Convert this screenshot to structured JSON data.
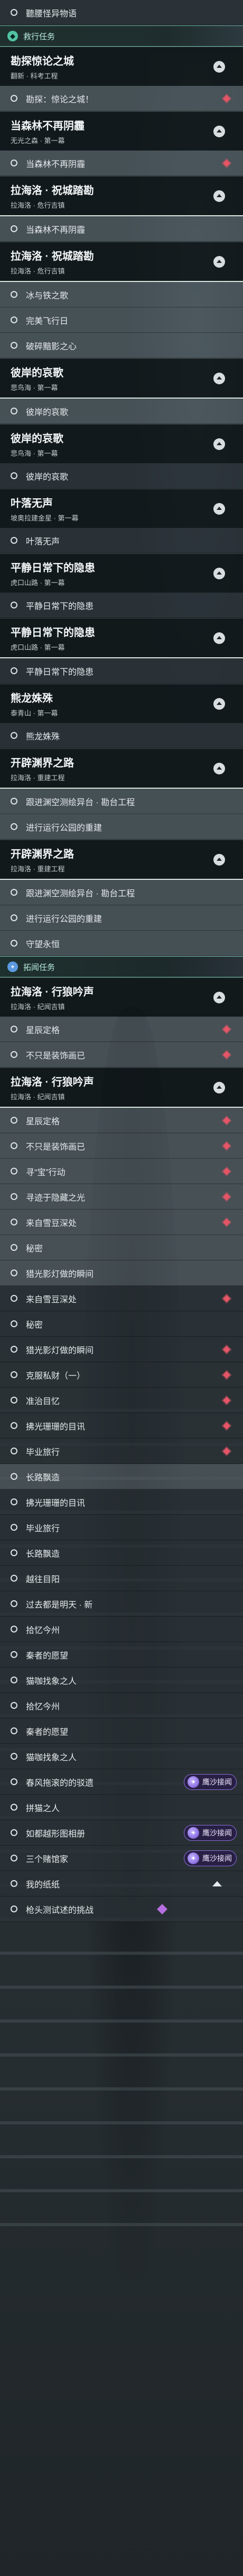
{
  "colors": {
    "accent_teal": "#6fb8a5",
    "marker_red": "#e45566",
    "badge_purple": "#8b6fd8"
  },
  "categories": {
    "main": {
      "label": "救行任务",
      "icon": "task-icon"
    },
    "side": {
      "label": "拓闻任务",
      "icon": "plus-icon"
    }
  },
  "rows": [
    {
      "kind": "task",
      "text": "聽腰怪异物语",
      "marker": false,
      "shade": "dark"
    },
    {
      "kind": "category",
      "ref": "main"
    },
    {
      "kind": "group",
      "title": "勘探惊论之城",
      "sub": "翻新 · 科考工程",
      "selected": false
    },
    {
      "kind": "task",
      "text": "勘探：惊论之城！",
      "marker": true,
      "shade": "light"
    },
    {
      "kind": "group",
      "title": "当森林不再阴霾",
      "sub": "无光之森 · 第一幕",
      "selected": false
    },
    {
      "kind": "task",
      "text": "当森林不再阴霾",
      "marker": true,
      "shade": "light"
    },
    {
      "kind": "group",
      "title": "拉海洛 · 祝城踏勘",
      "sub": "拉海洛 · 危行吉镇",
      "selected": true
    },
    {
      "kind": "task",
      "text": "当森林不再阴霾",
      "marker": false,
      "shade": "light"
    },
    {
      "kind": "group",
      "title": "拉海洛 · 祝城踏勘",
      "sub": "拉海洛 · 危行吉镇",
      "selected": true
    },
    {
      "kind": "task",
      "text": "冰与铁之歌",
      "marker": false,
      "shade": "light"
    },
    {
      "kind": "task",
      "text": "完美飞行日",
      "marker": false,
      "shade": "light"
    },
    {
      "kind": "task",
      "text": "破碎黯影之心",
      "marker": false,
      "shade": "light"
    },
    {
      "kind": "group",
      "title": "彼岸的哀歌",
      "sub": "悲鸟海 · 第一幕",
      "selected": true
    },
    {
      "kind": "task",
      "text": "彼岸的哀歌",
      "marker": false,
      "shade": "light"
    },
    {
      "kind": "group",
      "title": "彼岸的哀歌",
      "sub": "悲鸟海 · 第一幕",
      "selected": false
    },
    {
      "kind": "task",
      "text": "彼岸的哀歌",
      "marker": false,
      "shade": "dark"
    },
    {
      "kind": "group",
      "title": "叶落无声",
      "sub": "坡奥拉建金星 · 第一幕",
      "selected": false
    },
    {
      "kind": "task",
      "text": "叶落无声",
      "marker": false,
      "shade": "dark"
    },
    {
      "kind": "group",
      "title": "平静日常下的隐患",
      "sub": "虎口山路 · 第一幕",
      "selected": false
    },
    {
      "kind": "task",
      "text": "平静日常下的隐患",
      "marker": false,
      "shade": "dark"
    },
    {
      "kind": "group",
      "title": "平静日常下的隐患",
      "sub": "虎口山路 · 第一幕",
      "selected": true
    },
    {
      "kind": "task",
      "text": "平静日常下的隐患",
      "marker": false,
      "shade": "dark"
    },
    {
      "kind": "group",
      "title": "熊龙姝殊",
      "sub": "泰青山 · 第一幕",
      "selected": false
    },
    {
      "kind": "task",
      "text": "熊龙姝殊",
      "marker": false,
      "shade": "dark"
    },
    {
      "kind": "group",
      "title": "开辟渊界之路",
      "sub": "拉海洛 · 重建工程",
      "selected": true
    },
    {
      "kind": "task",
      "text": "跟进渊空测绘异台 · 勘台工程",
      "marker": false,
      "shade": "light"
    },
    {
      "kind": "task",
      "text": "进行运行公园的重建",
      "marker": false,
      "shade": "light"
    },
    {
      "kind": "group",
      "title": "开辟渊界之路",
      "sub": "拉海洛 · 重建工程",
      "selected": true
    },
    {
      "kind": "task",
      "text": "跟进渊空测绘异台 · 勘台工程",
      "marker": false,
      "shade": "light"
    },
    {
      "kind": "task",
      "text": "进行运行公园的重建",
      "marker": false,
      "shade": "light"
    },
    {
      "kind": "task",
      "text": "守望永恒",
      "marker": false,
      "shade": "light"
    },
    {
      "kind": "category",
      "ref": "side"
    },
    {
      "kind": "group",
      "title": "拉海洛 · 行狼吟声",
      "sub": "拉海洛 · 纪闻吉镇",
      "selected": false
    },
    {
      "kind": "task",
      "text": "星辰定格",
      "marker": true,
      "shade": "light"
    },
    {
      "kind": "task",
      "text": "不只是装饰画已",
      "marker": true,
      "shade": "light"
    },
    {
      "kind": "group",
      "title": "拉海洛 · 行狼吟声",
      "sub": "拉海洛 · 纪闻吉镇",
      "selected": true
    },
    {
      "kind": "task",
      "text": "星辰定格",
      "marker": true,
      "shade": "light"
    },
    {
      "kind": "task",
      "text": "不只是装饰画已",
      "marker": true,
      "shade": "light"
    },
    {
      "kind": "task",
      "text": "寻“宝”行动",
      "marker": true,
      "shade": "light"
    },
    {
      "kind": "task",
      "text": "寻迹于隐藏之光",
      "marker": true,
      "shade": "light"
    },
    {
      "kind": "task",
      "text": "来自雪豆深处",
      "marker": true,
      "shade": "light"
    },
    {
      "kind": "task",
      "text": "秘密",
      "marker": false,
      "shade": "light"
    },
    {
      "kind": "task",
      "text": "猎光影灯做的瞬间",
      "marker": false,
      "shade": "light"
    },
    {
      "kind": "task",
      "text": "来自雪豆深处",
      "marker": true,
      "shade": "dark"
    },
    {
      "kind": "task",
      "text": "秘密",
      "marker": false,
      "shade": "dark"
    },
    {
      "kind": "task",
      "text": "猎光影灯做的瞬间",
      "marker": true,
      "shade": "dark"
    },
    {
      "kind": "task",
      "text": "克服私财（一）",
      "marker": true,
      "shade": "dark"
    },
    {
      "kind": "task",
      "text": "准治目忆",
      "marker": true,
      "shade": "dark"
    },
    {
      "kind": "task",
      "text": "拂光珊珊的目讯",
      "marker": true,
      "shade": "dark"
    },
    {
      "kind": "task",
      "text": "毕业旅行",
      "marker": true,
      "shade": "dark"
    },
    {
      "kind": "task",
      "text": "长路飘造",
      "marker": false,
      "shade": "light"
    },
    {
      "kind": "task",
      "text": "拂光珊珊的目讯",
      "marker": false,
      "shade": "dark"
    },
    {
      "kind": "task",
      "text": "毕业旅行",
      "marker": false,
      "shade": "dark"
    },
    {
      "kind": "task",
      "text": "长路飘造",
      "marker": false,
      "shade": "dark"
    },
    {
      "kind": "task",
      "text": "越往目阳",
      "marker": false,
      "shade": "dark"
    },
    {
      "kind": "task",
      "text": "过去都是明天 · 新",
      "marker": false,
      "shade": "dark"
    },
    {
      "kind": "task",
      "text": "拾忆今州",
      "marker": false,
      "shade": "dark"
    },
    {
      "kind": "task",
      "text": "秦者的愿望",
      "marker": false,
      "shade": "dark"
    },
    {
      "kind": "task",
      "text": "猫咖找象之人",
      "marker": false,
      "shade": "dark"
    },
    {
      "kind": "task",
      "text": "拾忆今州",
      "marker": false,
      "shade": "dark"
    },
    {
      "kind": "task",
      "text": "秦者的愿望",
      "marker": false,
      "shade": "dark"
    },
    {
      "kind": "task",
      "text": "猫咖找象之人",
      "marker": false,
      "shade": "dark"
    },
    {
      "kind": "task",
      "text": "春风拖滚的的驳遗",
      "marker": false,
      "shade": "dark",
      "badge": "鹰沙接闻"
    },
    {
      "kind": "task",
      "text": "拼猫之人",
      "marker": false,
      "shade": "dark"
    },
    {
      "kind": "task",
      "text": "如都越形图相册",
      "marker": false,
      "shade": "dark",
      "badge": "鹰沙接闻"
    },
    {
      "kind": "task",
      "text": "三个赌馆家",
      "marker": false,
      "shade": "dark",
      "badge": "鹰沙接闻"
    },
    {
      "kind": "task",
      "text": "我的纸纸",
      "marker": false,
      "shade": "dark",
      "caret": true
    },
    {
      "kind": "task",
      "text": "枪头测试述的挑战",
      "marker": false,
      "shade": "dark",
      "end": true
    }
  ]
}
